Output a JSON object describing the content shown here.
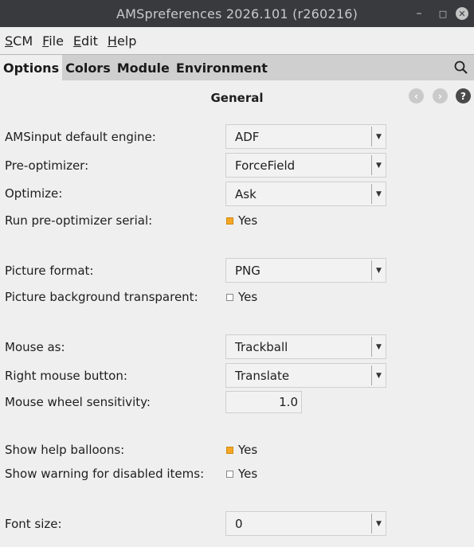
{
  "window": {
    "title": "AMSpreferences 2026.101 (r260216)",
    "min": "–",
    "max": "□",
    "close": "✕"
  },
  "menu": [
    {
      "first": "S",
      "rest": "CM"
    },
    {
      "first": "F",
      "rest": "ile"
    },
    {
      "first": "E",
      "rest": "dit"
    },
    {
      "first": "H",
      "rest": "elp"
    }
  ],
  "tabs": [
    "Options",
    "Colors",
    "Module",
    "Environment"
  ],
  "section": {
    "title": "General"
  },
  "fields": {
    "engine": {
      "label": "AMSinput default engine:",
      "value": "ADF"
    },
    "preopt": {
      "label": "Pre-optimizer:",
      "value": "ForceField"
    },
    "optimize": {
      "label": "Optimize:",
      "value": "Ask"
    },
    "preopt_serial": {
      "label": "Run pre-optimizer serial:",
      "value": "Yes",
      "checked": true
    },
    "picture_format": {
      "label": "Picture format:",
      "value": "PNG"
    },
    "picture_bg": {
      "label": "Picture background transparent:",
      "value": "Yes",
      "checked": false
    },
    "mouse_as": {
      "label": "Mouse as:",
      "value": "Trackball"
    },
    "right_mouse": {
      "label": "Right mouse button:",
      "value": "Translate"
    },
    "wheel": {
      "label": "Mouse wheel sensitivity:",
      "value": "1.0"
    },
    "help_balloons": {
      "label": "Show help balloons:",
      "value": "Yes",
      "checked": true
    },
    "warn_disabled": {
      "label": "Show warning for disabled items:",
      "value": "Yes",
      "checked": false
    },
    "font_size": {
      "label": "Font size:",
      "value": "0"
    }
  },
  "icons": {
    "search": "search-icon",
    "back": "back-arrow-icon",
    "forward": "forward-arrow-icon",
    "help": "help-icon",
    "dropdown": "dropdown-arrow-icon"
  },
  "colors": {
    "checked": "#f5a623",
    "title_bar": "#383a3e"
  }
}
